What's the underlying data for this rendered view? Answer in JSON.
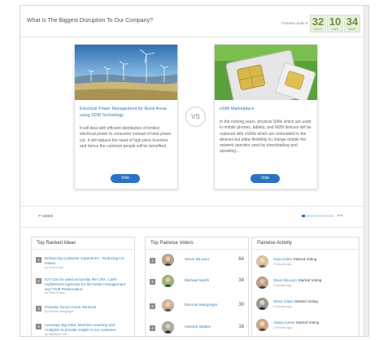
{
  "header": {
    "question": "What Is The Biggest Disruption To Our Company?",
    "ends_label": "Pairwise ends in",
    "timer": [
      {
        "value": "32",
        "unit": "DAYS"
      },
      {
        "value": "10",
        "unit": "HRS"
      },
      {
        "value": "34",
        "unit": "MINS"
      }
    ]
  },
  "ideas": [
    {
      "title": "Electrical Power Management for Rural Areas using SDM Technology",
      "description": "It will deal with efficient distribution of limited electrical power to consumer instead of total power cut. It will replace the need of high price Inverters and hence the common people will be benefited.",
      "vote_label": "Vote"
    },
    {
      "title": "eSIM Marketplace",
      "description": "In the coming years, physical SIMs which are used in mobile phones, tablets, and M2M devices will be replaced with eSIMs which are embedded in the devices but allow flexibility to change mobile the network operator used by downloading and speaking...",
      "vote_label": "Vote"
    }
  ],
  "vs_label": "VS",
  "undo_label": "UNDO",
  "progress": {
    "value": 0.11,
    "label": "11%"
  },
  "panels": {
    "ranked": {
      "title": "Top Ranked Ideas",
      "items": [
        {
          "rank": "1",
          "title": "Enhancing Customer experience - Reducing CX Issues.",
          "by": "by Chris Coss"
        },
        {
          "rank": "2",
          "title": "IOT Can be used as tool By the CRA. Cash replishment Agencies for the better management and Theft Preservation",
          "by": "by Peter Peace"
        },
        {
          "rank": "3",
          "title": "Pairwise Smart Home Services",
          "by": "by Duncan Macgregor"
        },
        {
          "rank": "4",
          "title": "Leverage Big Data, Machine Learning and Analytics to provide insight to our customer",
          "by": "by Vanessa Ford"
        }
      ]
    },
    "voters": {
      "title": "Top Pairwise Voters",
      "items": [
        {
          "rank": "1",
          "name": "Steve DiLeuro",
          "score": "64"
        },
        {
          "rank": "2",
          "name": "Michael Murth",
          "score": "34"
        },
        {
          "rank": "3",
          "name": "Duncan Macgregor",
          "score": "30"
        },
        {
          "rank": "4",
          "name": "Hamish Walker",
          "score": "16"
        }
      ]
    },
    "activity": {
      "title": "Pairwise Activity",
      "items": [
        {
          "name": "Sara Goller",
          "action": "Started Voting",
          "time": "2 minutes ago"
        },
        {
          "name": "Steve DiLeuro",
          "action": "Started Voting",
          "time": "2 minutes ago"
        },
        {
          "name": "Steve Glass",
          "action": "Started Voting",
          "time": "2 minutes ago"
        },
        {
          "name": "Alaina Jones",
          "action": "Started Voting",
          "time": "2 minutes ago"
        }
      ]
    }
  },
  "colors": {
    "accent": "#2b74c5",
    "timer_green": "#6a8f3c",
    "link": "#2c7fc1"
  }
}
